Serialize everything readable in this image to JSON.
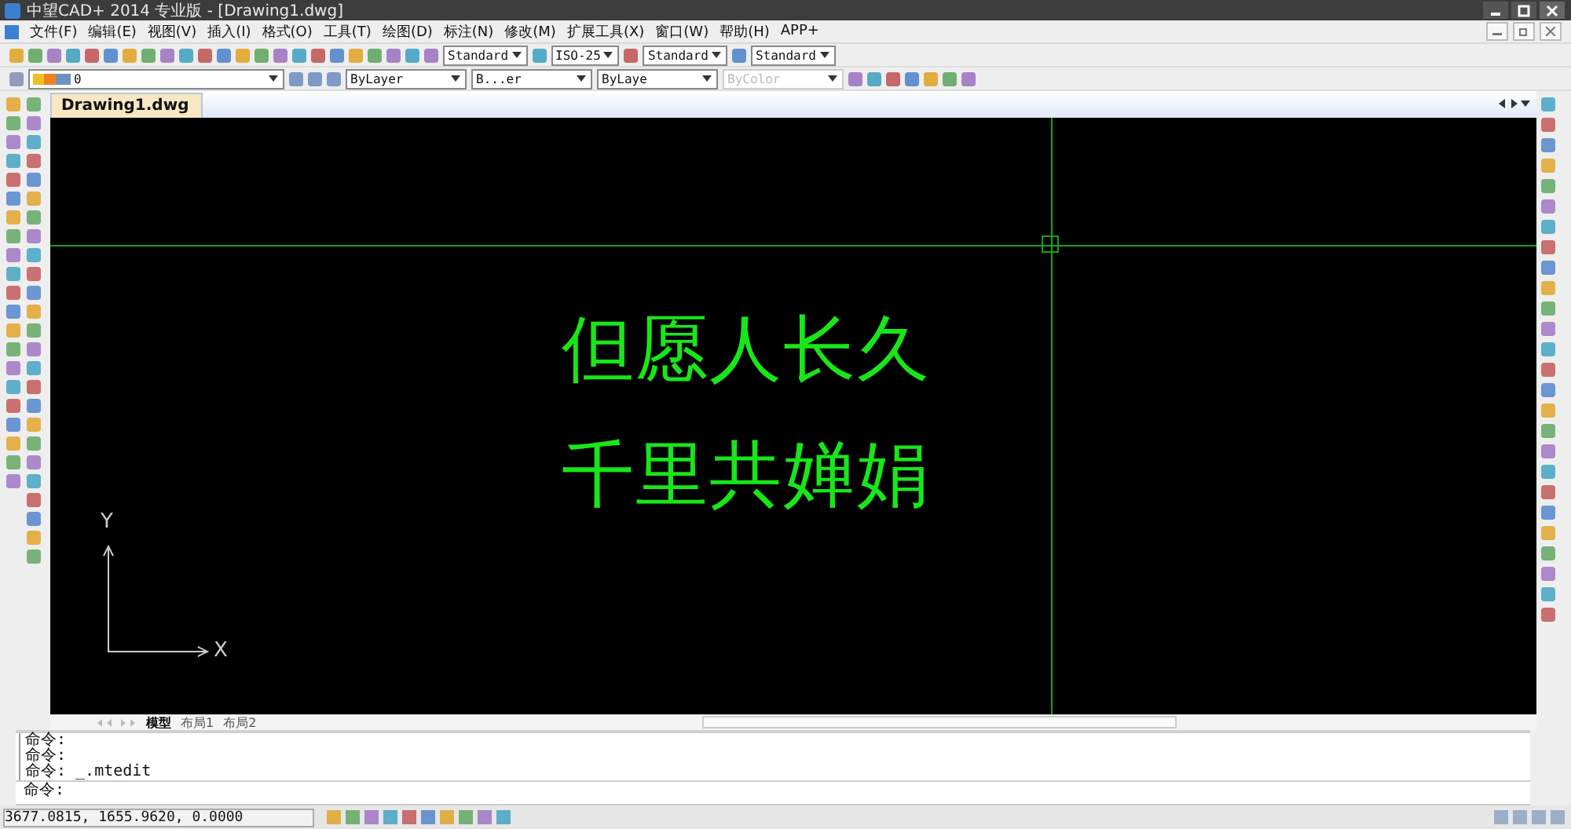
{
  "window": {
    "title": "中望CAD+ 2014 专业版 - [Drawing1.dwg]"
  },
  "menu": [
    "文件(F)",
    "编辑(E)",
    "视图(V)",
    "插入(I)",
    "格式(O)",
    "工具(T)",
    "绘图(D)",
    "标注(N)",
    "修改(M)",
    "扩展工具(X)",
    "窗口(W)",
    "帮助(H)",
    "APP+"
  ],
  "toolbar_1": {
    "dropdowns": [
      "Standard",
      "ISO-25",
      "Standard",
      "Standard"
    ]
  },
  "toolbar_2": {
    "layer": "0",
    "dropdowns": [
      {
        "label": "ByLayer",
        "disabled": false
      },
      {
        "label": "B...er",
        "disabled": false
      },
      {
        "label": "ByLaye",
        "disabled": false
      },
      {
        "label": "ByColor",
        "disabled": true
      }
    ]
  },
  "doc_tabs": [
    {
      "label": "Drawing1.dwg",
      "selected": true
    }
  ],
  "drawing": {
    "text_lines": [
      "但愿人长久",
      "千里共婵娟"
    ],
    "ucs": {
      "x_label": "X",
      "y_label": "Y"
    }
  },
  "layout_tabs": [
    {
      "label": "模型",
      "selected": true
    },
    {
      "label": "布局1",
      "selected": false
    },
    {
      "label": "布局2",
      "selected": false
    }
  ],
  "command_history": [
    "命令:",
    "命令:",
    "命令: _.mtedit"
  ],
  "command_prompt": "命令:",
  "status_bar": {
    "coordinates": "3677.0815, 1655.9620, 0.0000"
  }
}
